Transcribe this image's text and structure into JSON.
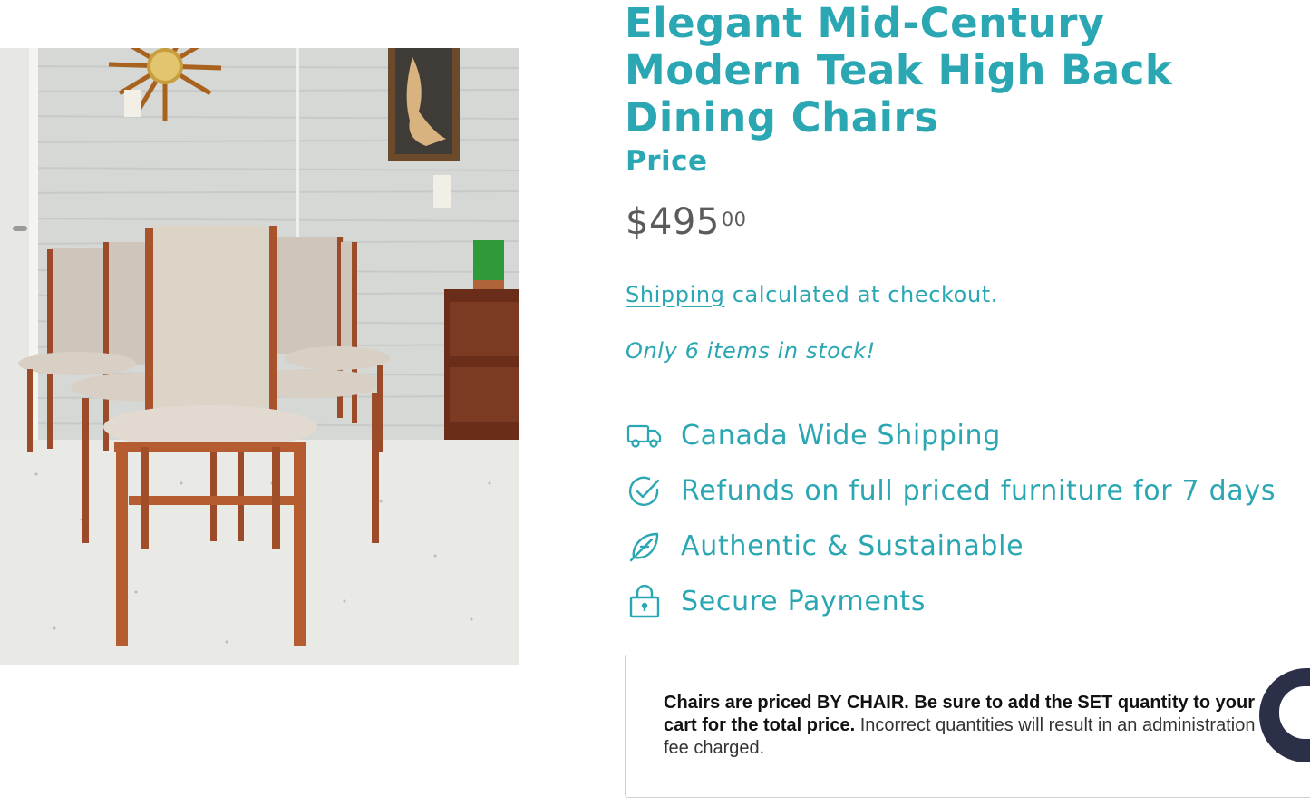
{
  "product": {
    "title": "Elegant Mid-Century Modern Teak High Back Dining Chairs",
    "image_alt": "Teak high back dining chairs"
  },
  "pricing": {
    "label": "Price",
    "currency_symbol": "$",
    "amount": "495",
    "cents": "00"
  },
  "shipping": {
    "link_text": "Shipping",
    "rest_text": " calculated at checkout."
  },
  "stock": {
    "message": "Only 6 items in stock!"
  },
  "features": [
    {
      "icon": "truck-icon",
      "label": "Canada Wide Shipping"
    },
    {
      "icon": "check-circle-icon",
      "label": "Refunds on full priced furniture for 7 days"
    },
    {
      "icon": "leaf-icon",
      "label": "Authentic & Sustainable"
    },
    {
      "icon": "lock-icon",
      "label": "Secure Payments"
    }
  ],
  "notice": {
    "bold_text": "Chairs are priced BY CHAIR. Be sure to add the SET quantity to your cart for the total price.",
    "regular_text": " Incorrect quantities will result in an administration fee charged."
  },
  "theme": {
    "accent": "#2aa7b3",
    "price_text": "#5b5b5b",
    "chat_bubble": "#2c2f48"
  }
}
